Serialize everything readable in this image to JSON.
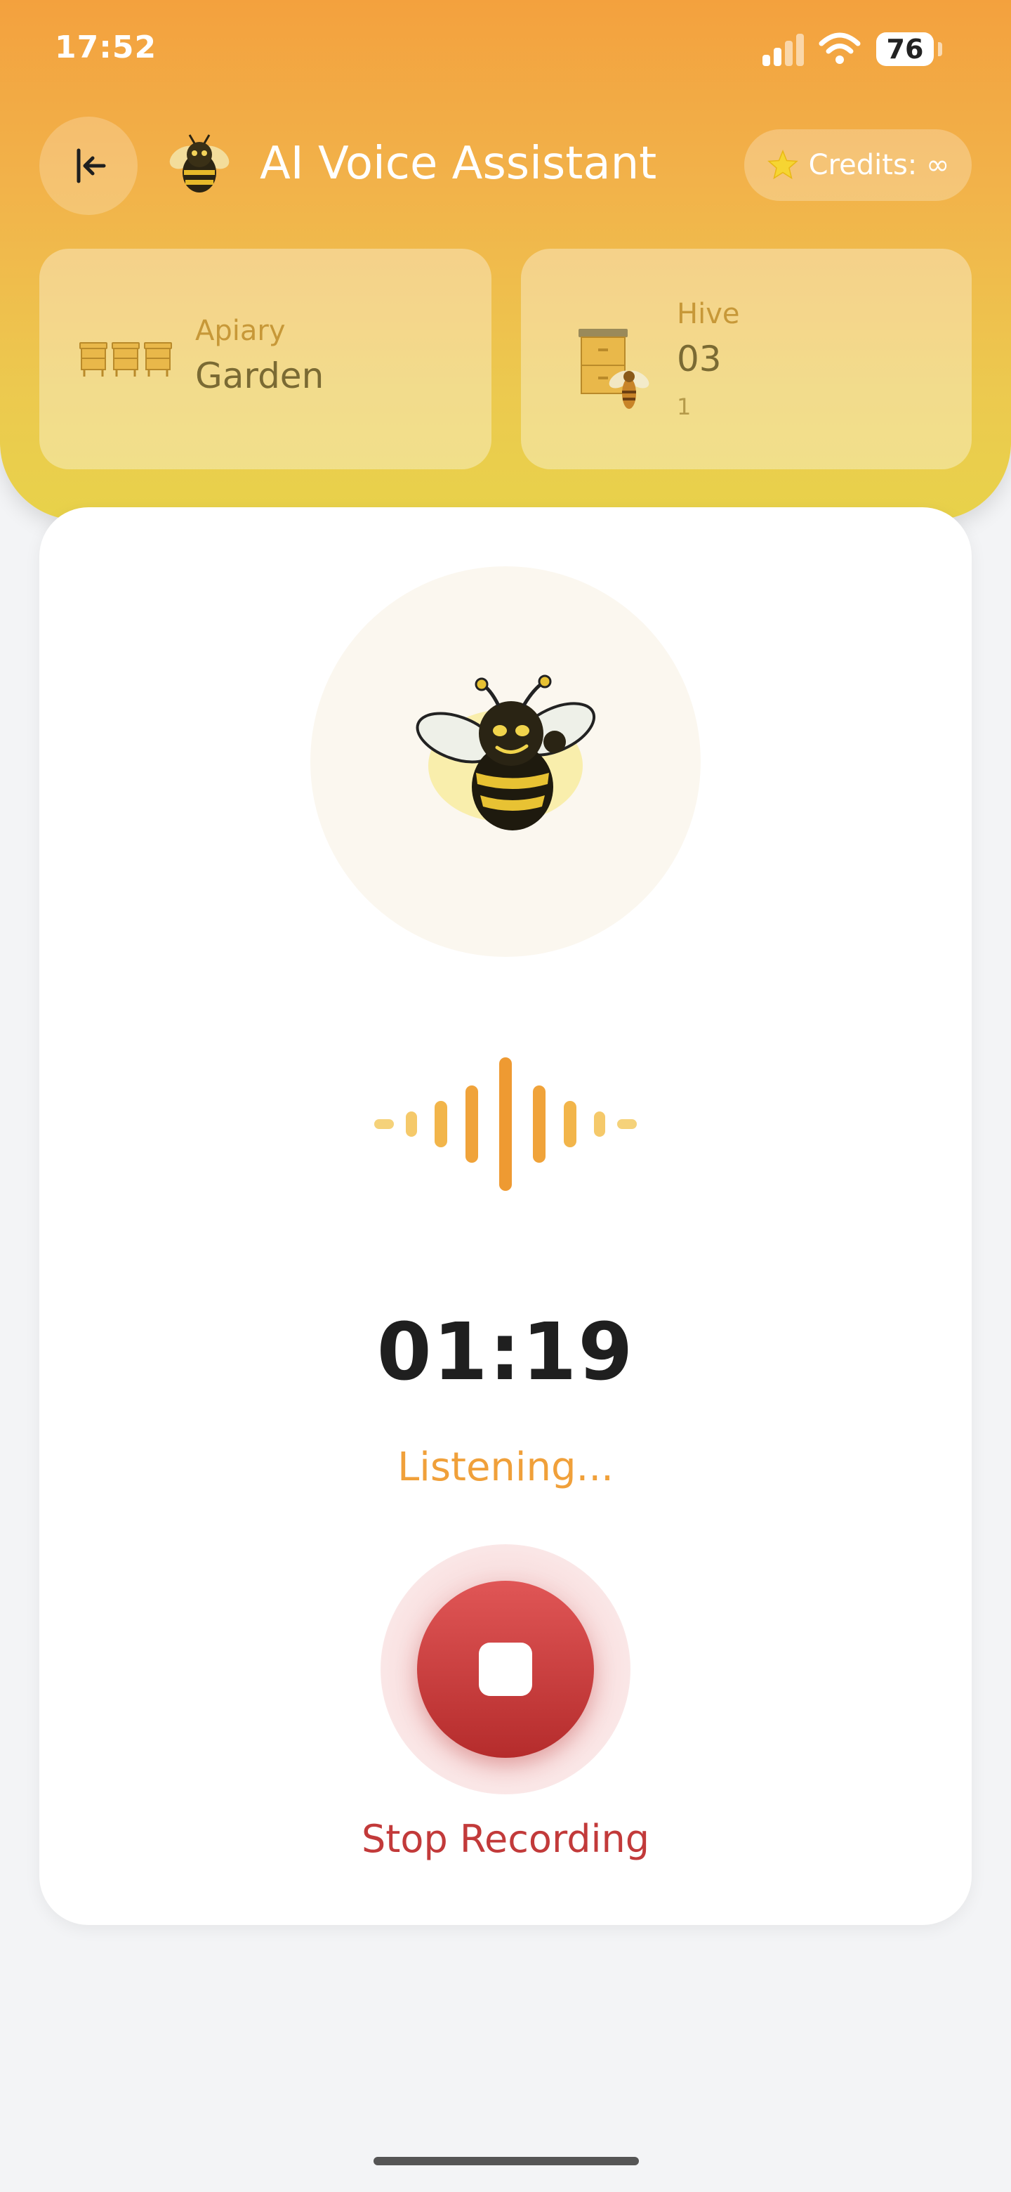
{
  "status_bar": {
    "time": "17:52",
    "battery": "76"
  },
  "header": {
    "title": "AI Voice Assistant",
    "credits_label": "Credits: ∞",
    "back_icon": "back-arrow-icon",
    "logo_icon": "bee-logo-icon",
    "credits_icon": "star-icon"
  },
  "apiary_card": {
    "label": "Apiary",
    "value": "Garden",
    "icon": "beehives-icon"
  },
  "hive_card": {
    "label": "Hive",
    "value": "03",
    "sub": "1",
    "icon": "hive-bee-icon"
  },
  "recorder": {
    "avatar_icon": "bee-mascot-icon",
    "waveform_icon": "waveform-icon",
    "timer": "01:19",
    "status": "Listening...",
    "stop_label": "Stop Recording",
    "stop_icon": "stop-icon"
  },
  "colors": {
    "header_top": "#f3a13e",
    "header_bottom": "#e8d24a",
    "accent_orange": "#f0a03a",
    "stop_red": "#c23a3a"
  }
}
